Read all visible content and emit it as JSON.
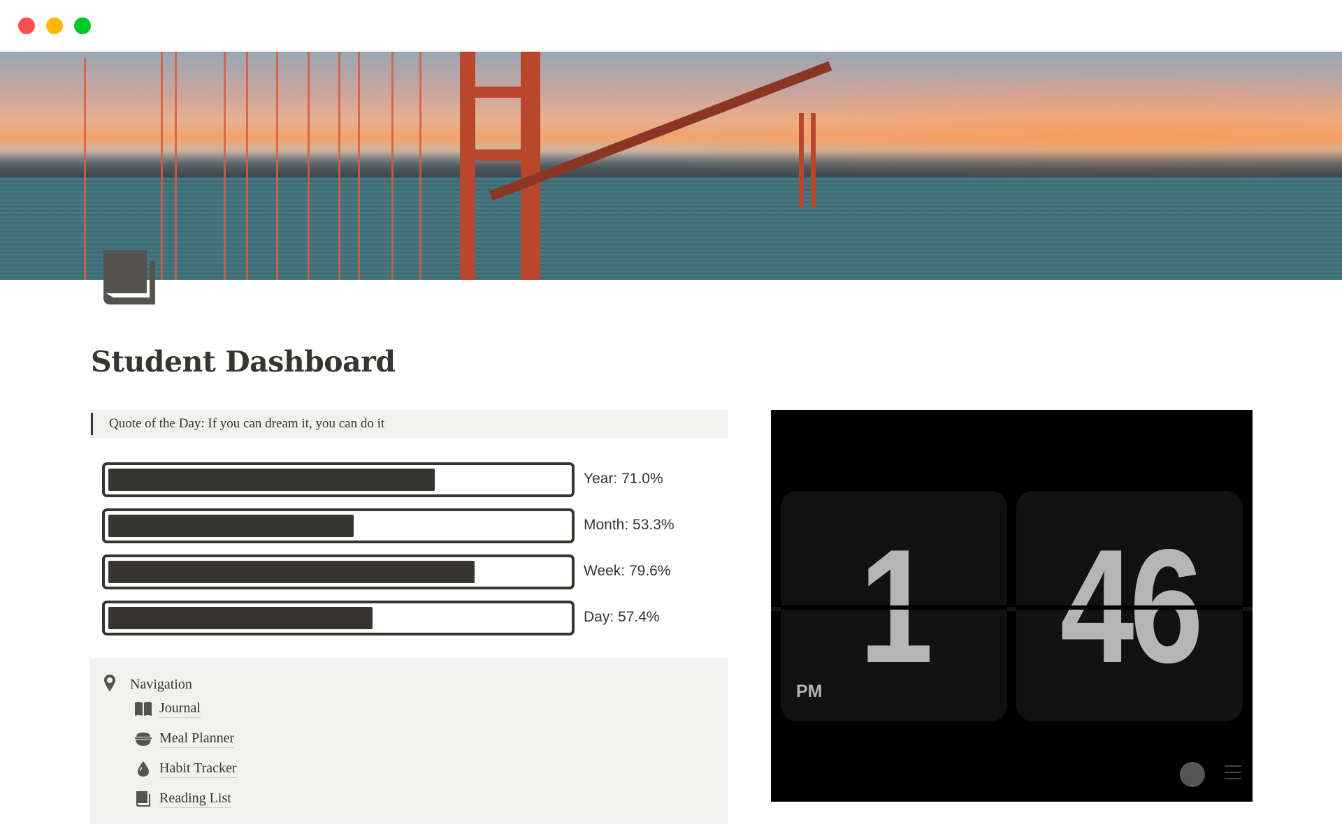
{
  "window": {
    "controls": [
      "close",
      "minimize",
      "maximize"
    ]
  },
  "banner": {
    "description": "Golden Gate Bridge at sunset cover image"
  },
  "page": {
    "icon": "book-pages-icon",
    "title": "Student Dashboard"
  },
  "quote": {
    "text": "Quote of the Day:  If you can dream it, you can do it"
  },
  "progress": [
    {
      "label": "Year: 71.0%",
      "percent": 71.0
    },
    {
      "label": "Month: 53.3%",
      "percent": 53.3
    },
    {
      "label": "Week: 79.6%",
      "percent": 79.6
    },
    {
      "label": "Day: 57.4%",
      "percent": 57.4
    }
  ],
  "navigation": {
    "heading": "Navigation",
    "heading_icon": "map-pin-icon",
    "items": [
      {
        "label": "Journal",
        "icon": "open-book-icon"
      },
      {
        "label": "Meal Planner",
        "icon": "bowl-icon"
      },
      {
        "label": "Habit Tracker",
        "icon": "drop-icon"
      },
      {
        "label": "Reading List",
        "icon": "pages-icon"
      }
    ]
  },
  "clock": {
    "hour": "1",
    "minute": "46",
    "period": "PM"
  },
  "colors": {
    "text": "#37352f",
    "callout_bg": "#f1f1ef",
    "clock_bg": "#000000",
    "flip_card": "#111111",
    "clock_digits": "#b5b5b5"
  }
}
